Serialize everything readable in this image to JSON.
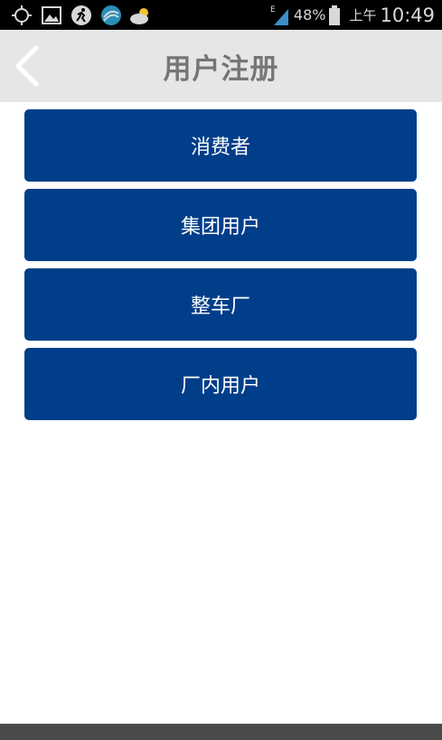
{
  "status_bar": {
    "network_type": "E",
    "battery_percent": "48%",
    "ampm": "上午",
    "time": "10:49",
    "icons": [
      "gps-icon",
      "image-icon",
      "sports-icon",
      "china-mobile-icon",
      "weather-icon",
      "signal-icon",
      "battery-icon"
    ]
  },
  "header": {
    "title": "用户注册",
    "back_icon": "chevron-left-icon"
  },
  "options": [
    {
      "label": "消费者"
    },
    {
      "label": "集团用户"
    },
    {
      "label": "整车厂"
    },
    {
      "label": "厂内用户"
    }
  ],
  "colors": {
    "button_bg": "#003e8a",
    "header_bg": "#e6e6e6",
    "title_text": "#767676"
  }
}
